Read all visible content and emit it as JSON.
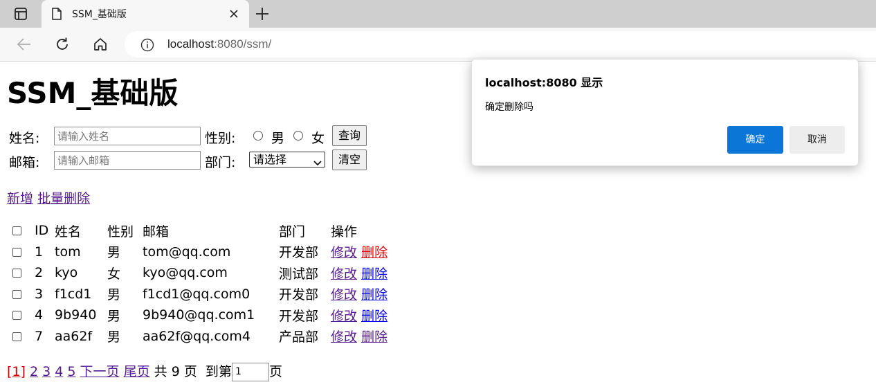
{
  "browser": {
    "tab_title": "SSM_基础版",
    "url_host": "localhost",
    "url_rest": ":8080/ssm/"
  },
  "page": {
    "title": "SSM_基础版",
    "search": {
      "name_label": "姓名:",
      "name_placeholder": "请输入姓名",
      "gender_label": "性别:",
      "gender_male": "男",
      "gender_female": "女",
      "query_button": "查询",
      "email_label": "邮箱:",
      "email_placeholder": "请输入邮箱",
      "dept_label": "部门:",
      "dept_selected": "请选择",
      "clear_button": "清空"
    },
    "actions": {
      "add": "新增",
      "batch_delete": "批量删除"
    },
    "table": {
      "headers": [
        "ID",
        "姓名",
        "性别",
        "邮箱",
        "部门",
        "操作"
      ],
      "edit_label": "修改",
      "delete_label": "删除",
      "rows": [
        {
          "id": "1",
          "name": "tom",
          "gender": "男",
          "email": "tom@qq.com",
          "dept": "开发部"
        },
        {
          "id": "2",
          "name": "kyo",
          "gender": "女",
          "email": "kyo@qq.com",
          "dept": "测试部"
        },
        {
          "id": "3",
          "name": "f1cd1",
          "gender": "男",
          "email": "f1cd1@qq.com0",
          "dept": "开发部"
        },
        {
          "id": "4",
          "name": "9b940",
          "gender": "男",
          "email": "9b940@qq.com1",
          "dept": "开发部"
        },
        {
          "id": "7",
          "name": "aa62f",
          "gender": "男",
          "email": "aa62f@qq.com4",
          "dept": "产品部"
        }
      ]
    },
    "pager": {
      "current": "[1]",
      "pages": [
        "2",
        "3",
        "4",
        "5"
      ],
      "next": "下一页",
      "last": "尾页",
      "total": "共 9 页",
      "goto_prefix": "到第",
      "goto_value": "1",
      "goto_suffix": "页"
    }
  },
  "dialog": {
    "title": "localhost:8080 显示",
    "message": "确定删除吗",
    "ok": "确定",
    "cancel": "取消"
  },
  "colors": {
    "dialog_ok_bg": "#0b76d8",
    "visited_link": "#551a8b",
    "unvisited_link": "#0000ee",
    "active_link": "#ee0000",
    "current_page": "#cc0000"
  }
}
